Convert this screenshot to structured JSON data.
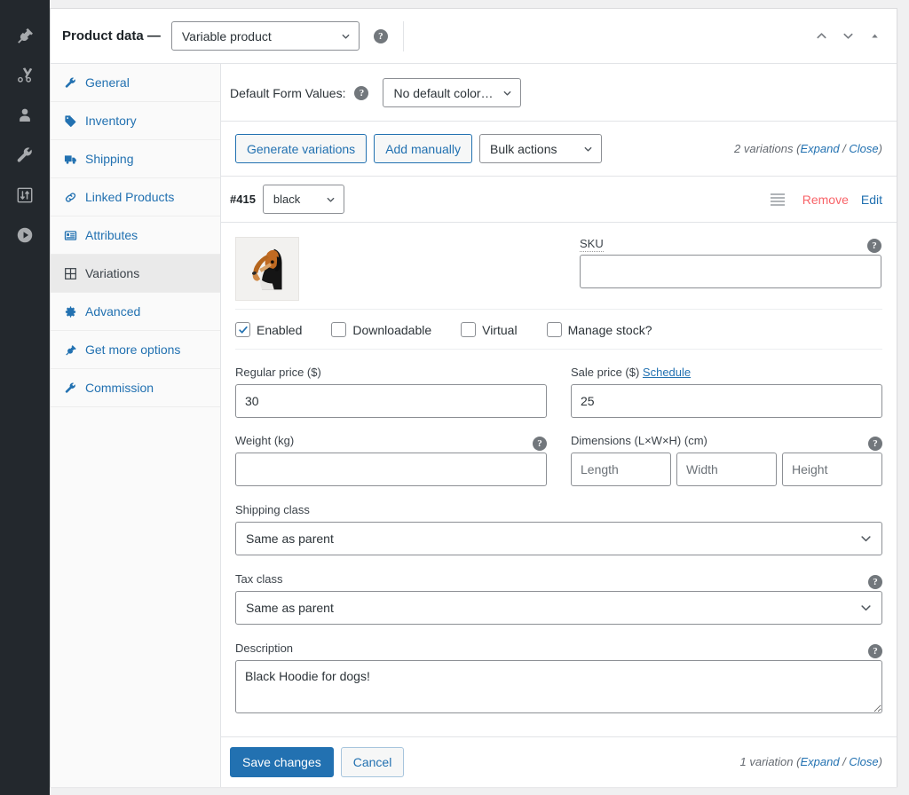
{
  "admin_rail": {
    "icons": [
      "plug-icon",
      "scissors-icon",
      "user-icon",
      "wrench-icon",
      "sliders-icon",
      "play-icon"
    ]
  },
  "panel": {
    "title": "Product data —",
    "product_type": "Variable product",
    "help_icon": "help-icon",
    "controls": {
      "move_up": "chevron-up-icon",
      "move_down": "chevron-down-icon",
      "toggle": "triangle-up-icon"
    }
  },
  "tabs": [
    {
      "label": "General",
      "icon": "wrench-icon",
      "active": false
    },
    {
      "label": "Inventory",
      "icon": "tag-icon",
      "active": false
    },
    {
      "label": "Shipping",
      "icon": "truck-icon",
      "active": false
    },
    {
      "label": "Linked Products",
      "icon": "link-icon",
      "active": false
    },
    {
      "label": "Attributes",
      "icon": "list-icon",
      "active": false
    },
    {
      "label": "Variations",
      "icon": "grid-icon",
      "active": true
    },
    {
      "label": "Advanced",
      "icon": "gear-icon",
      "active": false
    },
    {
      "label": "Get more options",
      "icon": "plug-icon",
      "active": false
    },
    {
      "label": "Commission",
      "icon": "wrench-icon",
      "active": false
    }
  ],
  "defaults_bar": {
    "label": "Default Form Values:",
    "help_icon": "help-icon",
    "selected": "No default color…"
  },
  "actions_bar": {
    "generate": "Generate variations",
    "add_manually": "Add manually",
    "bulk_actions": "Bulk actions",
    "count_text": "2 variations ",
    "expand": "Expand",
    "separator": " / ",
    "close": "Close"
  },
  "variation": {
    "id": "#415",
    "attribute_value": "black",
    "drag_handle": "drag-handle-icon",
    "remove": "Remove",
    "edit": "Edit",
    "thumbnail_alt": "dog-in-black-hoodie-thumbnail",
    "sku": {
      "label": "SKU",
      "value": "",
      "placeholder": ""
    },
    "checkboxes": [
      {
        "label": "Enabled",
        "checked": true
      },
      {
        "label": "Downloadable",
        "checked": false
      },
      {
        "label": "Virtual",
        "checked": false
      },
      {
        "label": "Manage stock?",
        "checked": false
      }
    ],
    "regular_price": {
      "label": "Regular price ($)",
      "value": "30"
    },
    "sale_price": {
      "label": "Sale price ($) ",
      "schedule_link": "Schedule",
      "value": "25"
    },
    "weight": {
      "label": "Weight (kg)",
      "value": ""
    },
    "dimensions": {
      "label": "Dimensions (L×W×H) (cm)",
      "length_placeholder": "Length",
      "width_placeholder": "Width",
      "height_placeholder": "Height",
      "length": "",
      "width": "",
      "height": ""
    },
    "shipping_class": {
      "label": "Shipping class",
      "value": "Same as parent"
    },
    "tax_class": {
      "label": "Tax class",
      "value": "Same as parent"
    },
    "description": {
      "label": "Description",
      "value": "Black Hoodie for dogs!"
    }
  },
  "footer": {
    "save": "Save changes",
    "cancel": "Cancel",
    "count_text": "1 variation ",
    "expand": "Expand",
    "separator": " / ",
    "close": "Close"
  },
  "colors": {
    "accent_blue": "#2271b1",
    "remove_red": "#f86368",
    "rail_dark": "#23282d",
    "page_bg": "#f0f0f1",
    "active_tab_bg": "#eaeaea"
  }
}
